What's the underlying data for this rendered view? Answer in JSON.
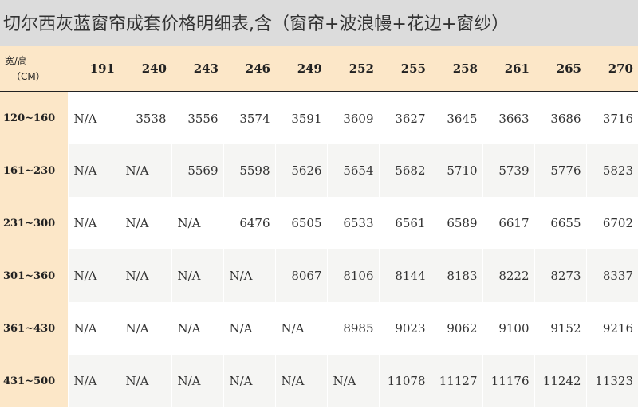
{
  "title": "切尔西灰蓝窗帘成套价格明细表,含（窗帘+波浪幔+花边+窗纱）",
  "table": {
    "corner_label": "宽/高",
    "corner_unit": "（CM）",
    "columns": [
      "191",
      "240",
      "243",
      "246",
      "249",
      "252",
      "255",
      "258",
      "261",
      "265",
      "270"
    ],
    "rows": [
      {
        "label": "120~160",
        "values": [
          "N/A",
          "3538",
          "3556",
          "3574",
          "3591",
          "3609",
          "3627",
          "3645",
          "3663",
          "3686",
          "3716"
        ]
      },
      {
        "label": "161~230",
        "values": [
          "N/A",
          "N/A",
          "5569",
          "5598",
          "5626",
          "5654",
          "5682",
          "5710",
          "5739",
          "5776",
          "5823"
        ]
      },
      {
        "label": "231~300",
        "values": [
          "N/A",
          "N/A",
          "N/A",
          "6476",
          "6505",
          "6533",
          "6561",
          "6589",
          "6617",
          "6655",
          "6702"
        ]
      },
      {
        "label": "301~360",
        "values": [
          "N/A",
          "N/A",
          "N/A",
          "N/A",
          "8067",
          "8106",
          "8144",
          "8183",
          "8222",
          "8273",
          "8337"
        ]
      },
      {
        "label": "361~430",
        "values": [
          "N/A",
          "N/A",
          "N/A",
          "N/A",
          "N/A",
          "8985",
          "9023",
          "9062",
          "9100",
          "9152",
          "9216"
        ]
      },
      {
        "label": "431~500",
        "values": [
          "N/A",
          "N/A",
          "N/A",
          "N/A",
          "N/A",
          "N/A",
          "11078",
          "11127",
          "11176",
          "11242",
          "11323"
        ]
      }
    ]
  },
  "colors": {
    "title_band": "#dcdcdc",
    "header_fill": "#fce7c8",
    "stripe": "#f5f5f3",
    "text": "#333333"
  }
}
